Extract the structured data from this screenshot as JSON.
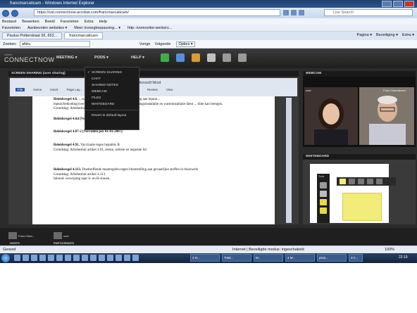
{
  "browser": {
    "title": "francmarcaticam - Windows Internet Explorer",
    "url": "https://cat.connectnow.acrobat.com/francmarcaticam/",
    "search_placeholder": "Live Search",
    "menu": [
      "Bestand",
      "Bewerken",
      "Beeld",
      "Favorieten",
      "Extra",
      "Help"
    ],
    "favorites": [
      "Favorieten",
      "Aanbevolen websites ▾",
      "Meer invoegtoepassing... ▾",
      "http--ivomonitor.werkers..."
    ],
    "tabs": [
      "Paulus Potterstraat 36, 652...",
      "francmarcaticam"
    ],
    "command_bar": [
      "Pagina ▾",
      "Beveiliging ▾",
      "Extra ▾"
    ],
    "find_label": "Zoeken:",
    "find_value": "afdru",
    "find_prev": "Vorige",
    "find_next": "Volgende",
    "find_options": "Opties ▾",
    "status_zone": "Internet | Beveiligde modus: ingeschakeld",
    "status_zoom": "100%",
    "status_left": "Gereed"
  },
  "app": {
    "logo_small": "Adobe",
    "logo": "CONNECTNOW",
    "menus": [
      "MEETING ▾",
      "PODS ▾",
      "HELP ▾"
    ],
    "pods_menu": [
      "SCREEN SHARING",
      "CHAT",
      "SHARED NOTES",
      "WEBCAM",
      "FILES",
      "WHITEBOARD"
    ],
    "pods_reset": "Revert to default layout",
    "screen_sharing_title": "SCREEN SHARING (user sharing)",
    "webcam_title": "WEBCAM",
    "whiteboard_title": "WHITEBOARD",
    "cam_name_left": "user",
    "cam_name_right": "Franz Marcaticam",
    "whiteboard_tools_label": "Tools",
    "bottom_pods": {
      "host_tile": "Franz Marc...",
      "participant_tile": "user",
      "hosts_label": "HOSTS",
      "participants_label": "PARTICIPANTS"
    }
  },
  "word": {
    "window_title": "...ocx) [Compatibility Mode] - Microsoft Word",
    "tabs": [
      "File",
      "Home",
      "Insert",
      "Page Lay...",
      "Review",
      "View"
    ],
    "paragraphs": [
      {
        "bold": "Beleidsregel 4.6.",
        "text": " ...voorkoming of beperking van blootstelling aan lepton..."
      },
      {
        "bold": "",
        "text": "lepton/bekleding/overlopend ...boren van een luchtbevochtigingsinstallatie en waterinstallatie dient ... tilde kan brengen."
      },
      {
        "bold": "",
        "text": "Grondslag: Arbobesluit ... 4.17a, eerste lid."
      },
      {
        "bold": "Beleidsregel 4.6d [Vervallen per 19-06-2002]",
        "text": ""
      },
      {
        "bold": "Beleidsregel 4.87-2 [Vervallen per 01-01-2007]",
        "text": ""
      },
      {
        "bold": "Beleidsregel 4.91.",
        "text": " Vaccinatie tegen hepatitis B"
      },
      {
        "bold": "",
        "text": "Grondslag: Arbobesluit artikel 4.91, eerste, achtste en negende lid"
      },
      {
        "bold": "Beleidsregel 4.113.",
        "text": " Doeltreffende maatregelen tegen blootstelling aan gevaarlijke stoffen in thuiswerk"
      },
      {
        "bold": "",
        "text": "Grondslag: Arbobesluit artikel 4.113."
      },
      {
        "bold": "",
        "text": "Inhoud: verwijzing naar S- en R-zinnen."
      }
    ]
  },
  "taskbar": {
    "tasks": [
      "4 In...",
      "Total...",
      "M...",
      "4 M...",
      "prua...",
      "3 A...",
      "ad..."
    ],
    "clock": "22:19"
  },
  "colors": {
    "app_bg": "#2b2b2b",
    "ie_title": "#1f3f6e",
    "sticky_note": "#f2ec7a"
  }
}
